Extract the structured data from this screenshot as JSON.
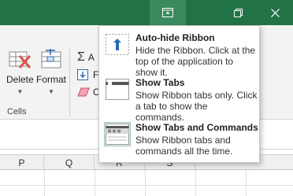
{
  "titlebar": {
    "buttons": [
      {
        "name": "ribbon-display-options",
        "icon": "ribbon-display-options-icon"
      },
      {
        "name": "restore",
        "icon": "restore-icon"
      },
      {
        "name": "close",
        "icon": "close-icon"
      }
    ]
  },
  "ribbon": {
    "cells_group": {
      "delete_label": "Delete",
      "format_label": "Format",
      "group_label": "Cells"
    },
    "editing_group": {
      "autosum_label": "A",
      "fill_label": "F",
      "clear_label": "C"
    }
  },
  "columns": [
    "P",
    "Q",
    "R",
    "S"
  ],
  "menu": {
    "items": [
      {
        "title": "Auto-hide Ribbon",
        "description": "Hide the Ribbon. Click at the top of the application to show it.",
        "icon": "auto-hide-ribbon-icon"
      },
      {
        "title": "Show Tabs",
        "description": "Show Ribbon tabs only. Click a tab to show the commands.",
        "icon": "show-tabs-icon"
      },
      {
        "title": "Show Tabs and Commands",
        "description": "Show Ribbon tabs and commands all the time.",
        "icon": "show-tabs-commands-icon"
      }
    ]
  },
  "colors": {
    "titlebar": "#217346",
    "accent_blue": "#2b6cb0",
    "delete_red": "#d9534f"
  }
}
